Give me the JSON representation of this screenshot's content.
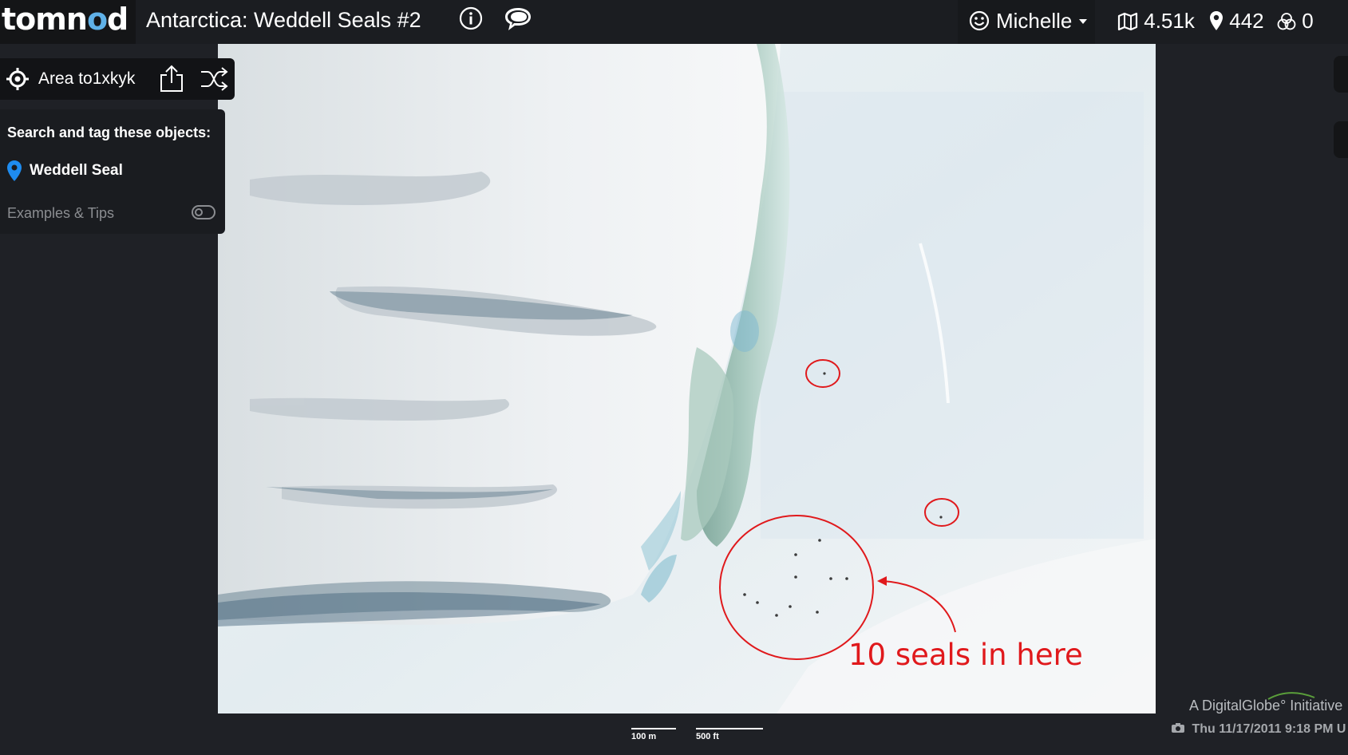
{
  "app": {
    "logo_part1": "t",
    "logo_o1": "o",
    "logo_part2": "mn",
    "logo_o2": "o",
    "logo_part3": "d",
    "title": "Antarctica: Weddell Seals #2"
  },
  "header": {
    "info_icon": "info-icon",
    "chat_icon": "chat-icon"
  },
  "user": {
    "name": "Michelle",
    "icon": "smiley-icon"
  },
  "stats": {
    "map_count": "4.51k",
    "tag_count": "442",
    "agreement_count": "0"
  },
  "area": {
    "label": "Area to1xkyk",
    "icons": [
      "target-icon",
      "share-icon",
      "shuffle-icon"
    ]
  },
  "task": {
    "heading": "Search and tag these objects:",
    "object": "Weddell Seal",
    "tips_label": "Examples & Tips",
    "pin_color": "#1e8cf0"
  },
  "annotation": {
    "text": "10 seals in here",
    "color": "#e0191c"
  },
  "scale": {
    "meters": "100 m",
    "feet": "500 ft"
  },
  "footer": {
    "credit": "A DigitalGlobe° Initiative",
    "datetime": "Thu 11/17/2011 9:18 PM U"
  }
}
